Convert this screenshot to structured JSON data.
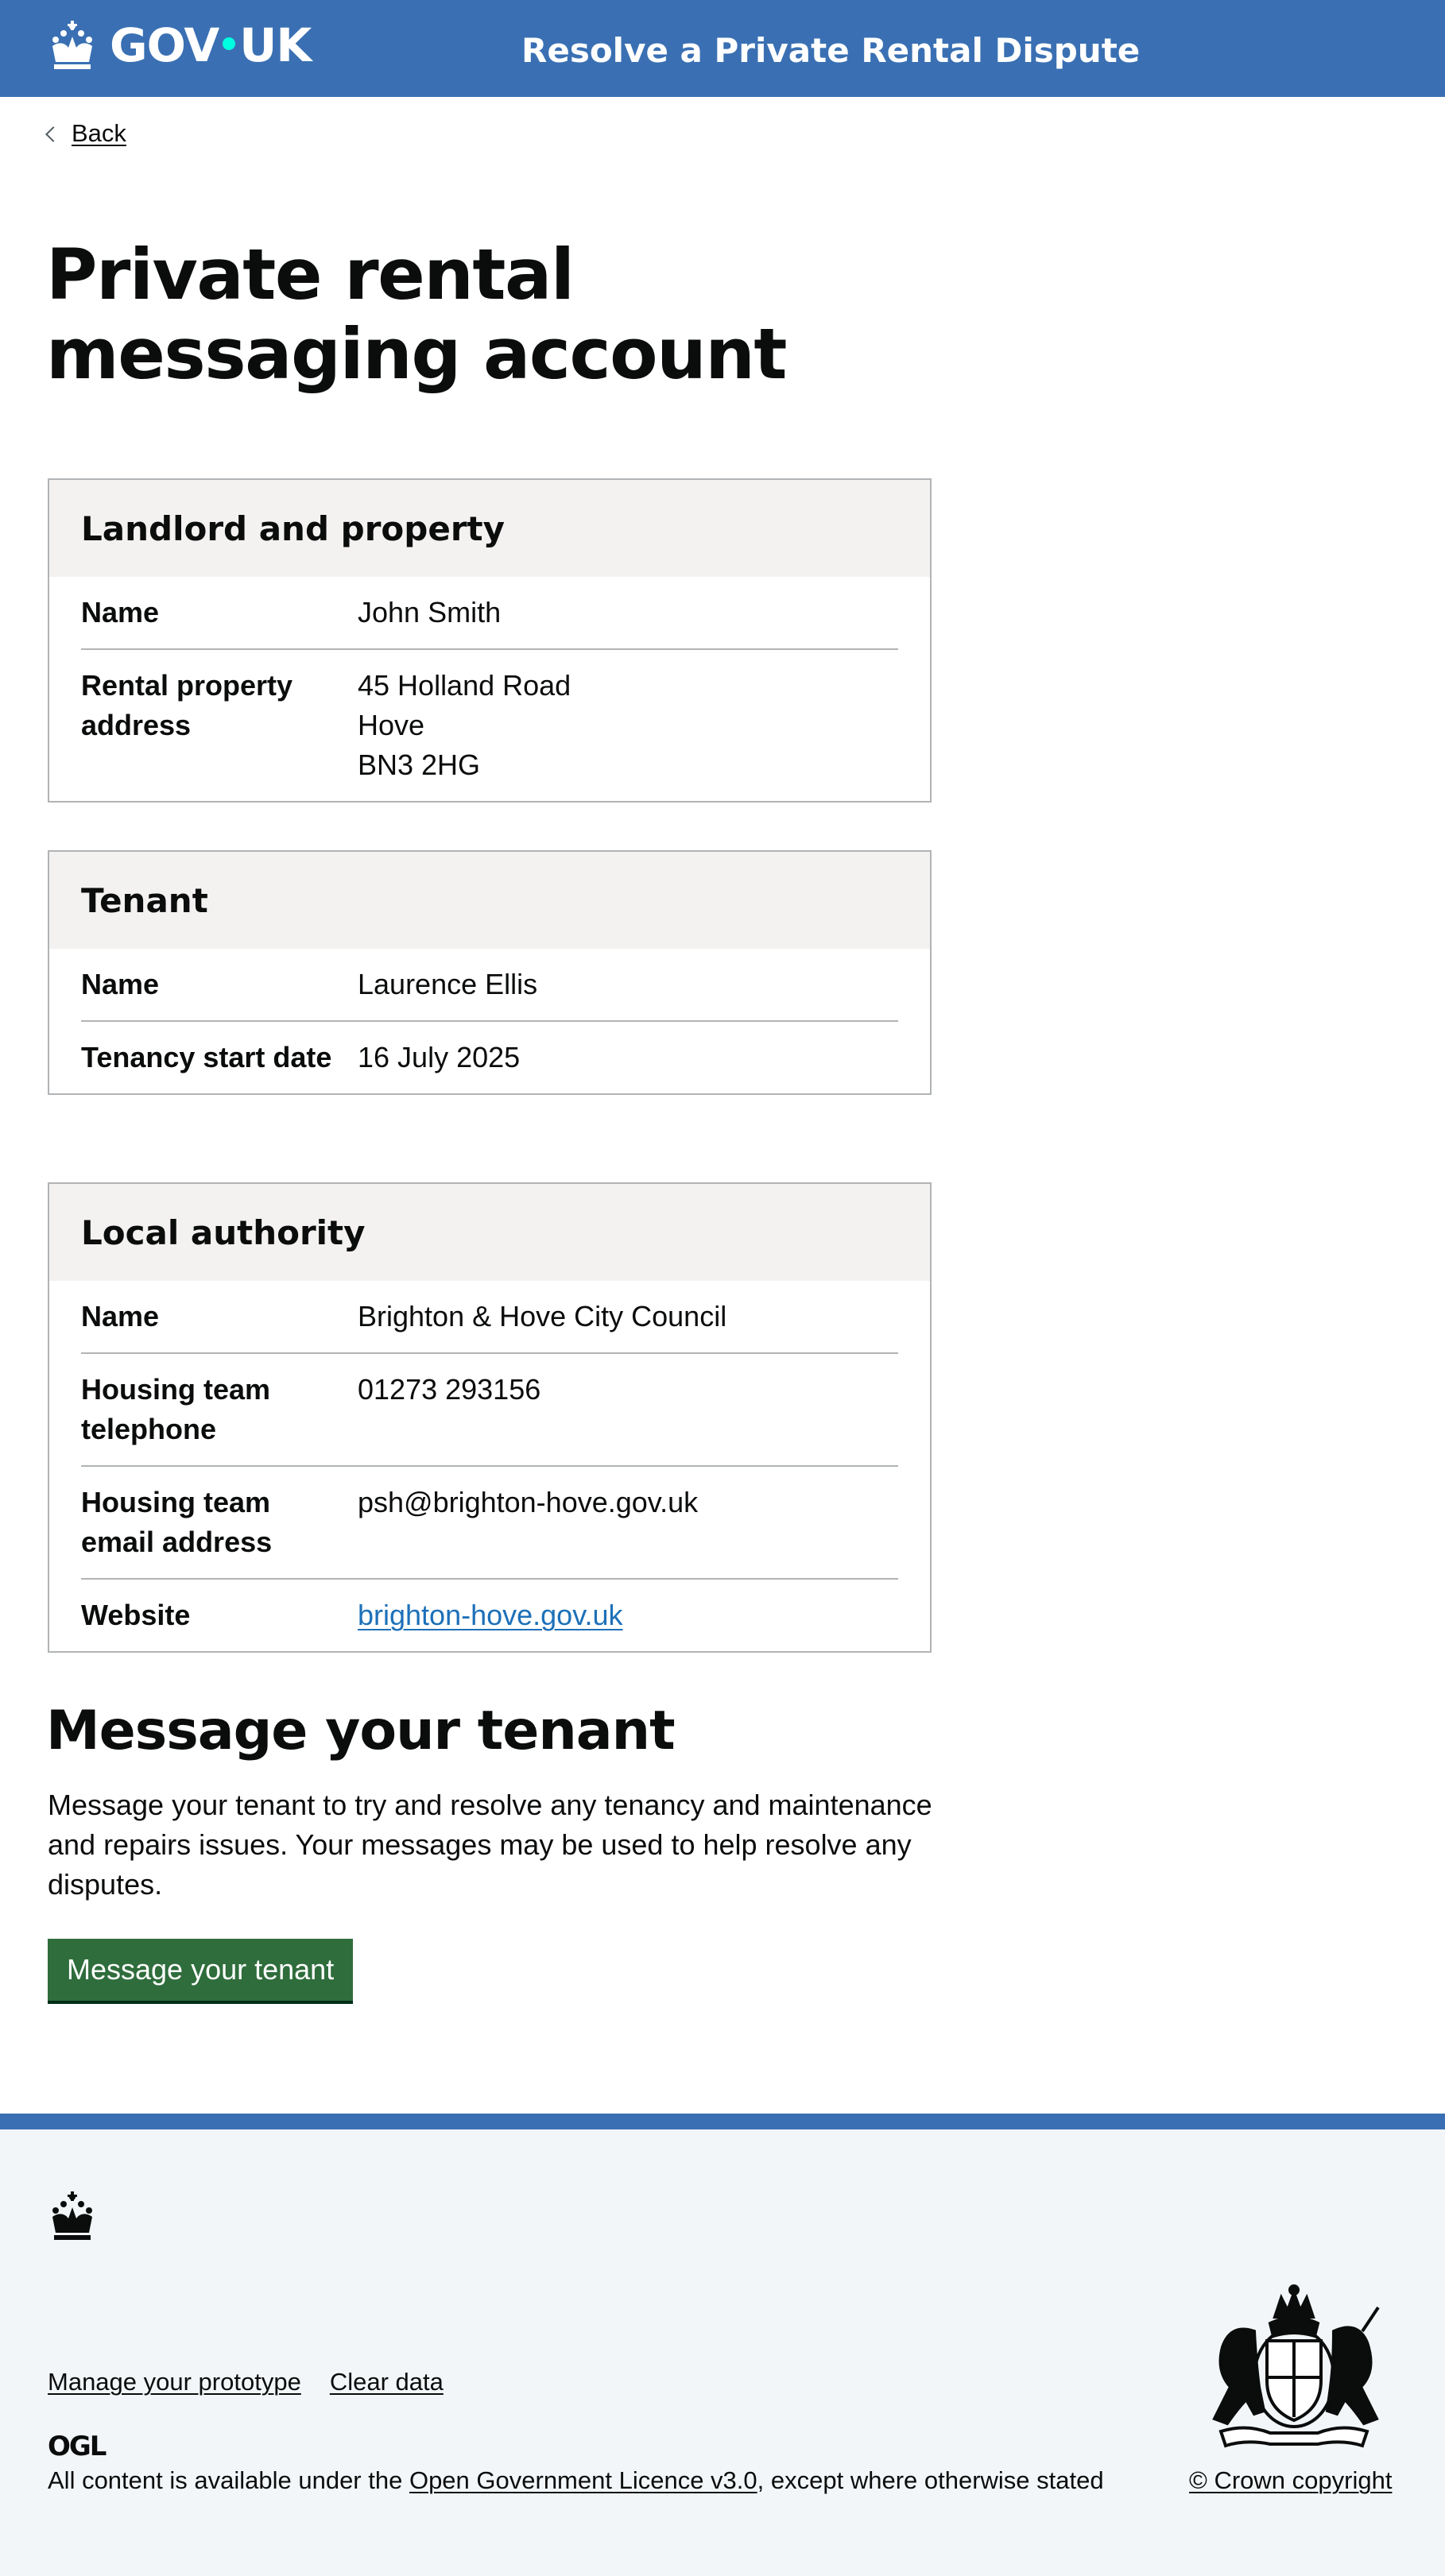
{
  "header": {
    "logo_text_left": "GOV",
    "logo_text_right": "UK",
    "service_name": "Resolve a Private Rental Dispute",
    "accent_color": "#3a70b3"
  },
  "back_link": {
    "label": "Back"
  },
  "page_title": "Private rental messaging account",
  "cards": {
    "landlord": {
      "title": "Landlord and property",
      "name_key": "Name",
      "name_value": "John Smith",
      "address_key": "Rental property address",
      "address_lines": [
        "45 Holland Road",
        "Hove",
        "BN3 2HG"
      ]
    },
    "tenant": {
      "title": "Tenant",
      "name_key": "Name",
      "name_value": "Laurence Ellis",
      "start_key": "Tenancy start date",
      "start_value": "16 July 2025"
    },
    "authority": {
      "title": "Local authority",
      "name_key": "Name",
      "name_value": "Brighton & Hove City Council",
      "phone_key": "Housing team telephone",
      "phone_value": "01273 293156",
      "email_key": "Housing team email address",
      "email_value": "psh@brighton-hove.gov.uk",
      "website_key": "Website",
      "website_value": "brighton-hove.gov.uk"
    }
  },
  "message_section": {
    "heading": "Message your tenant",
    "body": "Message your tenant to try and resolve any tenancy and maintenance and repairs issues. Your messages may be used to help resolve any disputes.",
    "button_label": "Message your tenant",
    "button_color": "#2f6d3c"
  },
  "footer": {
    "links": [
      "Manage your prototype",
      "Clear data"
    ],
    "ogl_label": "OGL",
    "licence_prefix": "All content is available under the ",
    "licence_link": "Open Government Licence v3.0",
    "licence_suffix": ", except where otherwise stated",
    "copyright": "© Crown copyright",
    "background_color": "#f3f6f9"
  }
}
